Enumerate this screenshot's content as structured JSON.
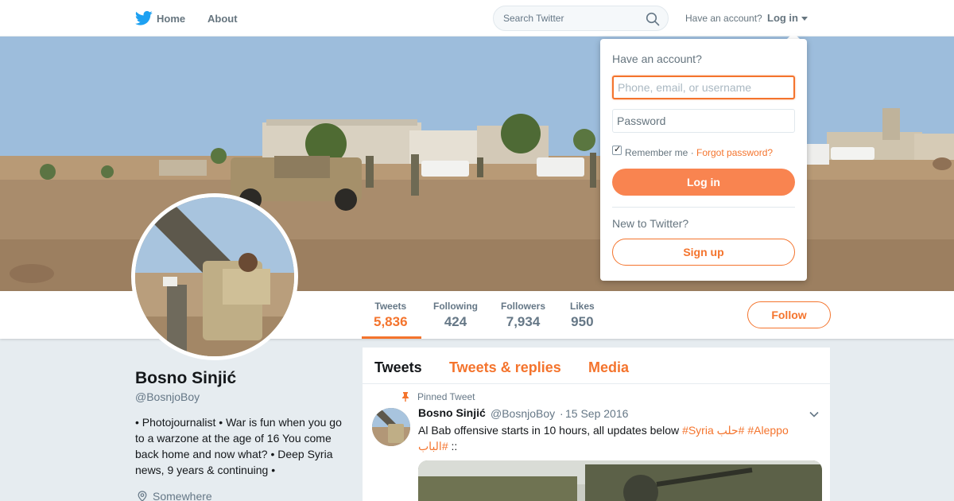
{
  "colors": {
    "accent": "#f4742d",
    "brand_blue": "#1da1f2",
    "muted": "#657786"
  },
  "nav": {
    "logo_icon": "twitter-bird-icon",
    "home": "Home",
    "about": "About",
    "search_placeholder": "Search Twitter",
    "have_account": "Have an account?",
    "login": "Log in"
  },
  "login_dropdown": {
    "title": "Have an account?",
    "username_placeholder": "Phone, email, or username",
    "password_placeholder": "Password",
    "remember_me": "Remember me",
    "remember_checked": true,
    "separator": "·",
    "forgot": "Forgot password?",
    "login_button": "Log in",
    "new_to_twitter": "New to Twitter?",
    "signup_button": "Sign up"
  },
  "stats": [
    {
      "label": "Tweets",
      "value": "5,836",
      "active": true
    },
    {
      "label": "Following",
      "value": "424",
      "active": false
    },
    {
      "label": "Followers",
      "value": "7,934",
      "active": false
    },
    {
      "label": "Likes",
      "value": "950",
      "active": false
    }
  ],
  "follow_button": "Follow",
  "profile": {
    "name": "Bosno Sinjić",
    "handle": "@BosnjoBoy",
    "bio": "• Photojournalist • War is fun when you go to a warzone at the age of 16 You come back home and now what? • Deep Syria news, 9 years & continuing •",
    "location": "Somewhere"
  },
  "timeline": {
    "tabs": [
      "Tweets",
      "Tweets & replies",
      "Media"
    ],
    "pinned_label": "Pinned Tweet",
    "tweet": {
      "name": "Bosno Sinjić",
      "handle": "@BosnjoBoy",
      "dot": "·",
      "date": "15 Sep 2016",
      "text_plain": "Al Bab offensive starts in 10 hours, all updates below ",
      "tag_syria": "#Syria",
      "tag_arabic": "#حلب",
      "tag_aleppo": "#Aleppo",
      "tag_albab": "#الباب",
      "trailing": " ::"
    }
  }
}
